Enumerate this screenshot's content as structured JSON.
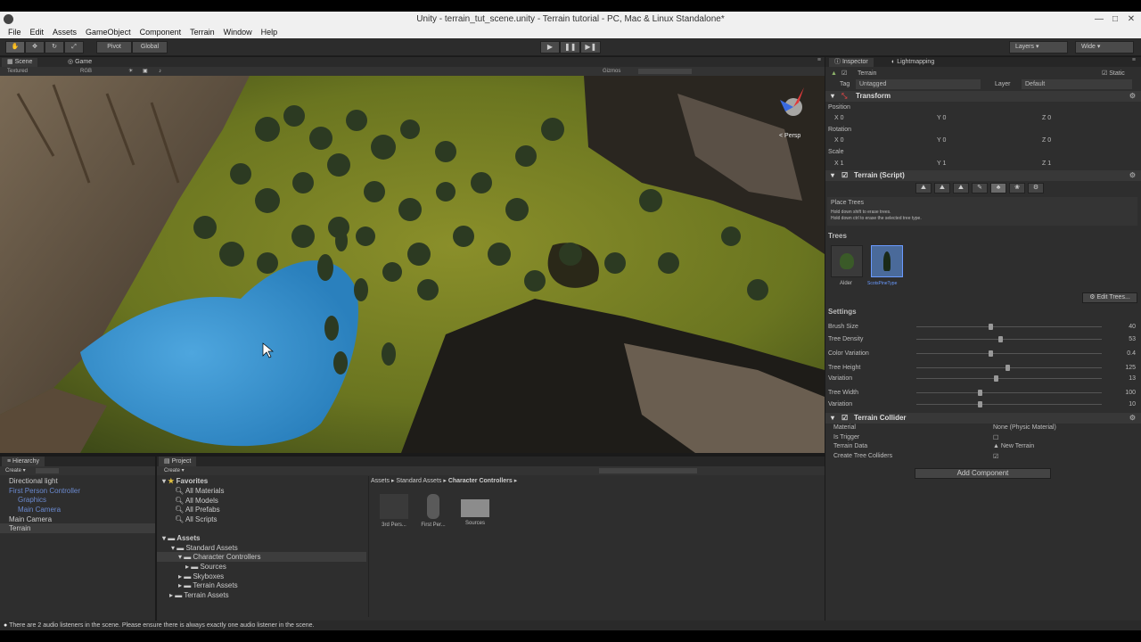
{
  "window": {
    "title": "Unity - terrain_tut_scene.unity - Terrain tutorial - PC, Mac & Linux Standalone*"
  },
  "menu": [
    "File",
    "Edit",
    "Assets",
    "GameObject",
    "Component",
    "Terrain",
    "Window",
    "Help"
  ],
  "toolbar": {
    "pivot": "Pivot",
    "global": "Global",
    "layers": "Layers",
    "layout": "Wide"
  },
  "scene": {
    "tab_scene": "Scene",
    "tab_game": "Game",
    "render_mode": "Textured",
    "color_mode": "RGB",
    "gizmos": "Gizmos",
    "persp": "< Persp"
  },
  "inspector": {
    "tab_inspector": "Inspector",
    "tab_lightmapping": "Lightmapping",
    "object_name": "Terrain",
    "static": "Static",
    "tag_label": "Tag",
    "tag_value": "Untagged",
    "layer_label": "Layer",
    "layer_value": "Default",
    "transform_title": "Transform",
    "position": "Position",
    "rotation": "Rotation",
    "scale": "Scale",
    "pos": {
      "x": "0",
      "y": "0",
      "z": "0"
    },
    "rot": {
      "x": "0",
      "y": "0",
      "z": "0"
    },
    "scl": {
      "x": "1",
      "y": "1",
      "z": "1"
    },
    "terrain_script_title": "Terrain (Script)",
    "place_trees": "Place Trees",
    "hint1": "Hold down shift to erase trees.",
    "hint2": "Hold down ctrl to erase the selected tree type.",
    "trees_title": "Trees",
    "tree1": "Alder",
    "tree2": "ScotsPineType",
    "edit_trees": "Edit Trees...",
    "settings_title": "Settings",
    "settings": [
      {
        "label": "Brush Size",
        "value": "40",
        "pos": 0.4
      },
      {
        "label": "Tree Density",
        "value": "53",
        "pos": 0.45
      },
      {
        "label": "Color Variation",
        "value": "0.4",
        "pos": 0.4
      },
      {
        "label": "Tree Height",
        "value": "125",
        "pos": 0.49
      },
      {
        "label": "Variation",
        "value": "13",
        "pos": 0.43
      },
      {
        "label": "Tree Width",
        "value": "100",
        "pos": 0.34
      },
      {
        "label": "Variation",
        "value": "10",
        "pos": 0.34
      }
    ],
    "collider_title": "Terrain Collider",
    "material_label": "Material",
    "material_value": "None (Physic Material)",
    "is_trigger": "Is Trigger",
    "terrain_data_label": "Terrain Data",
    "terrain_data_value": "New Terrain",
    "create_tree_colliders": "Create Tree Colliders",
    "add_component": "Add Component"
  },
  "hierarchy": {
    "tab": "Hierarchy",
    "create": "Create",
    "items": [
      {
        "label": "Directional light",
        "indent": 0,
        "style": "normal"
      },
      {
        "label": "First Person Controller",
        "indent": 0,
        "style": "blue"
      },
      {
        "label": "Graphics",
        "indent": 1,
        "style": "blue"
      },
      {
        "label": "Main Camera",
        "indent": 1,
        "style": "blue"
      },
      {
        "label": "Main Camera",
        "indent": 0,
        "style": "normal"
      },
      {
        "label": "Terrain",
        "indent": 0,
        "style": "selected"
      }
    ]
  },
  "project": {
    "tab": "Project",
    "create": "Create",
    "favorites": "Favorites",
    "fav_items": [
      "All Materials",
      "All Models",
      "All Prefabs",
      "All Scripts"
    ],
    "assets": "Assets",
    "tree": [
      "Standard Assets",
      "Character Controllers",
      "Sources",
      "Skyboxes",
      "Terrain Assets",
      "Terrain Assets"
    ],
    "breadcrumb": [
      "Assets",
      "Standard Assets",
      "Character Controllers"
    ],
    "files": [
      "3rd Pers...",
      "First Per...",
      "Sources"
    ]
  },
  "status": {
    "message": "There are 2 audio listeners in the scene. Please ensure there is always exactly one audio listener in the scene."
  },
  "colors": {
    "accent": "#6b8ad0",
    "water": "#3a9bd5",
    "grass": "#6a7a1f"
  }
}
